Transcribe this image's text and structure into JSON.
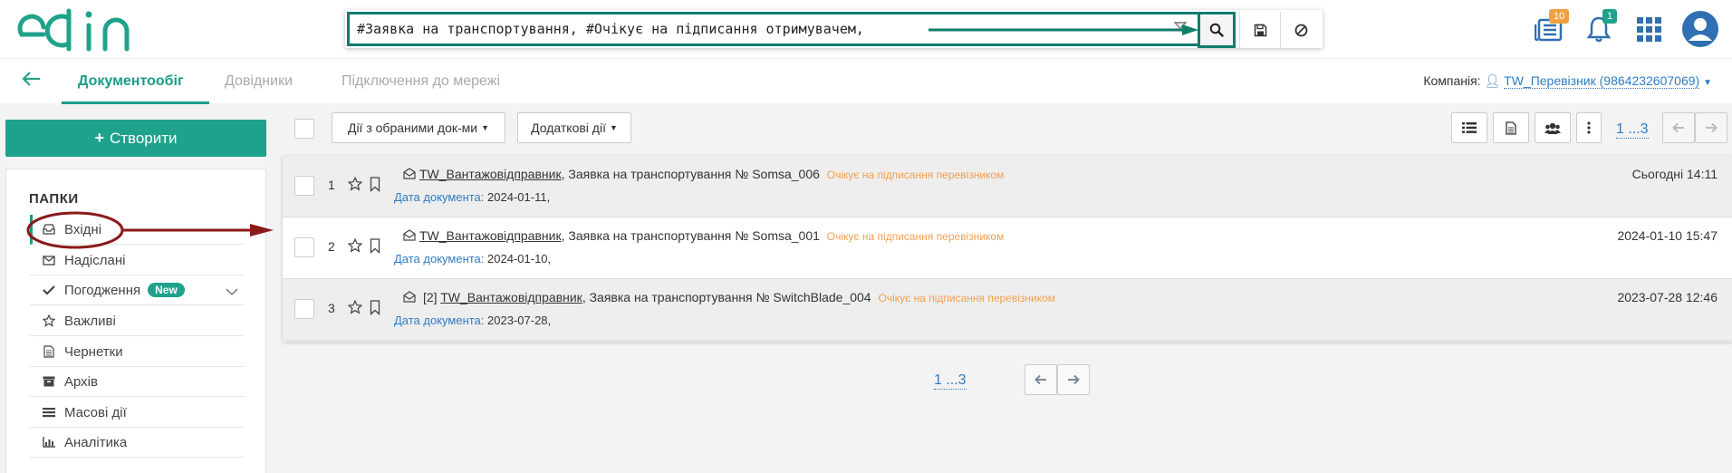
{
  "header": {
    "logo_text": "edin",
    "search": {
      "value": "#Заявка на транспортування, #Очікує на підписання отримувачем,",
      "placeholder": ""
    },
    "filter_clear": "⇤",
    "icons": [
      "search-icon",
      "save-icon",
      "ban-icon",
      "news-icon",
      "bell-icon",
      "apps-icon",
      "user-icon"
    ],
    "news_badge": "10",
    "bell_badge": "1"
  },
  "nav": {
    "tabs": [
      {
        "label": "Документообіг"
      },
      {
        "label": "Довідники"
      },
      {
        "label": "Підключення до мережі"
      }
    ],
    "company_label": "Компанія:",
    "company_value": "TW_Перевізник (9864232607069)"
  },
  "sidebar": {
    "create_label": "Створити",
    "folders_title": "ПАПКИ",
    "items": [
      {
        "label": "Вхідні",
        "icon": "inbox-icon"
      },
      {
        "label": "Надіслані",
        "icon": "envelope-icon"
      },
      {
        "label": "Погодження",
        "icon": "check-icon",
        "badge": "New"
      },
      {
        "label": "Важливі",
        "icon": "star-icon"
      },
      {
        "label": "Чернетки",
        "icon": "file-icon"
      },
      {
        "label": "Архів",
        "icon": "archive-icon"
      },
      {
        "label": "Масові дії",
        "icon": "list-icon"
      },
      {
        "label": "Аналітика",
        "icon": "chart-icon"
      }
    ]
  },
  "toolbar": {
    "actions_label": "Дії з обраними док-ми",
    "extra_label": "Додаткові дії",
    "pager_top": "1 ...3"
  },
  "documents": [
    {
      "num": "1",
      "prefix": "",
      "sender": "TW_Вантажовідправник",
      "title": ", Заявка на транспортування № Somsa_006",
      "status": "Очікує на підписання перевізником",
      "date_label": "Дата документа:",
      "date_value": "2024-01-11,",
      "time": "Сьогодні 14:11"
    },
    {
      "num": "2",
      "prefix": "",
      "sender": "TW_Вантажовідправник",
      "title": ", Заявка на транспортування № Somsa_001",
      "status": "Очікує на підписання перевізником",
      "date_label": "Дата документа:",
      "date_value": "2024-01-10,",
      "time": "2024-01-10 15:47"
    },
    {
      "num": "3",
      "prefix": "[2]",
      "sender": "TW_Вантажовідправник",
      "title": ", Заявка на транспортування № SwitchBlade_004",
      "status": "Очікує на підписання перевізником",
      "date_label": "Дата документа:",
      "date_value": "2023-07-28,",
      "time": "2023-07-28 12:46"
    }
  ],
  "pager_bottom": "1 ...3",
  "colors": {
    "brand": "#1fa28b",
    "annotation_teal": "#0f7d6b",
    "annotation_red": "#8b1a1a",
    "link": "#2f7cc2",
    "status": "#f0a050"
  }
}
